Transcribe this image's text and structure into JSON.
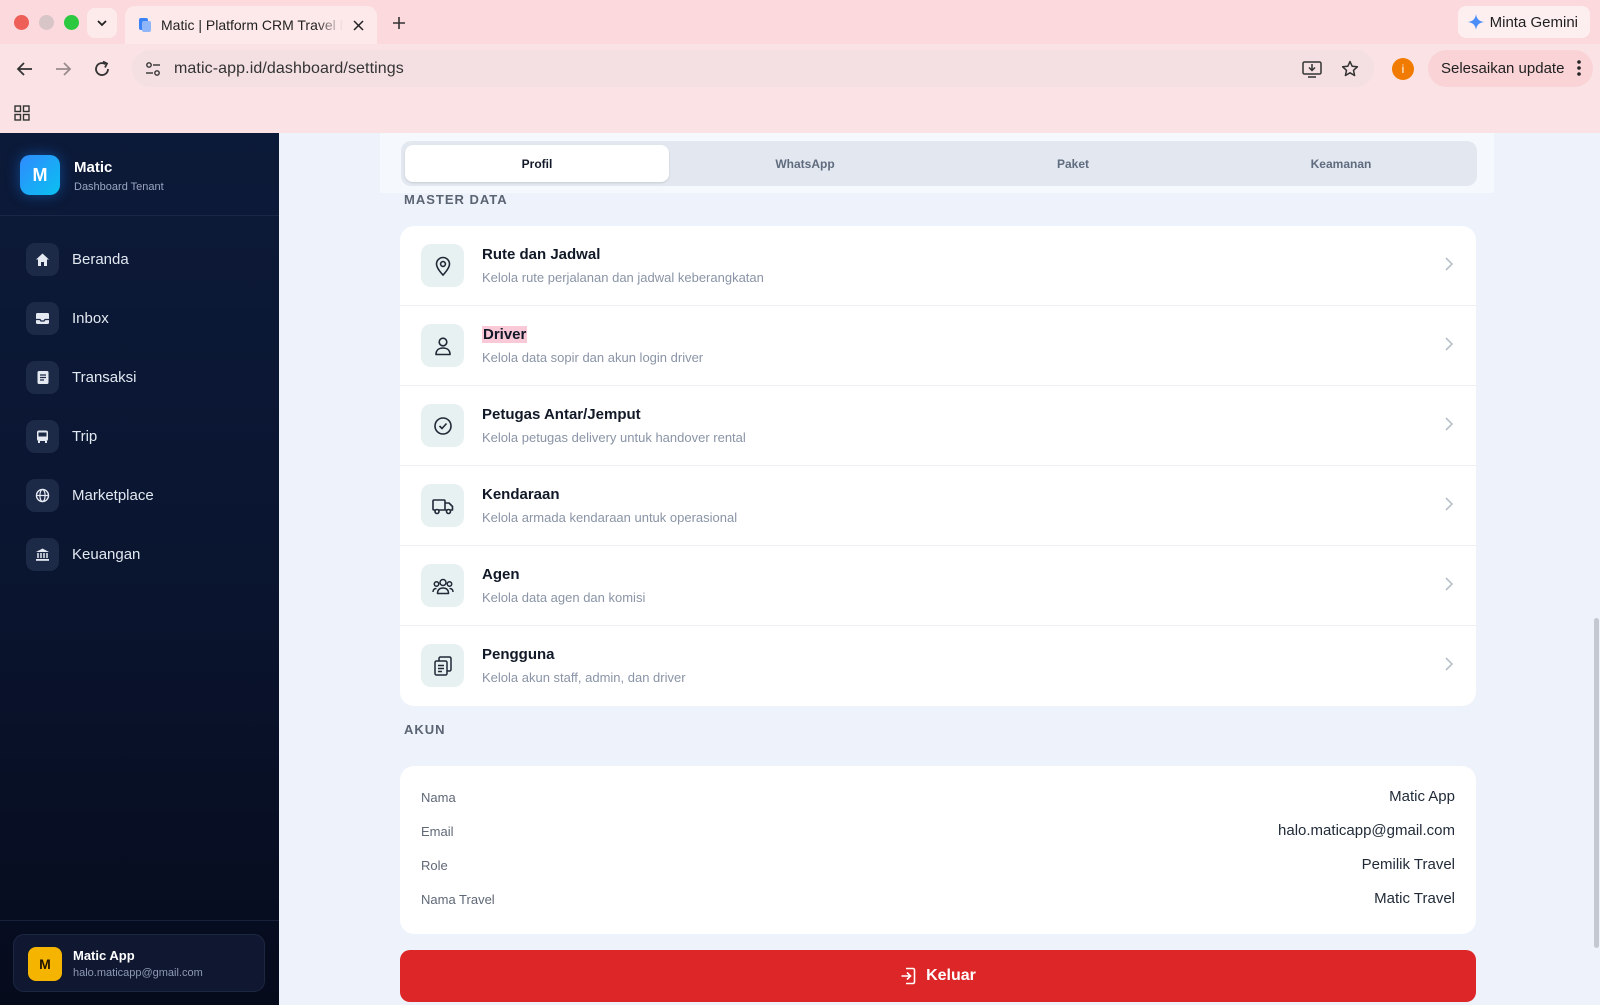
{
  "browser": {
    "tab_title": "Matic | Platform CRM Travel Dashboard",
    "url": "matic-app.id/dashboard/settings",
    "gemini_label": "Minta Gemini",
    "update_label": "Selesaikan update",
    "profile_initial": "i"
  },
  "sidebar": {
    "brand_initial": "M",
    "brand_name": "Matic",
    "brand_sub": "Dashboard Tenant",
    "items": [
      {
        "label": "Beranda",
        "icon": "home-icon"
      },
      {
        "label": "Inbox",
        "icon": "inbox-icon"
      },
      {
        "label": "Transaksi",
        "icon": "document-icon"
      },
      {
        "label": "Trip",
        "icon": "bus-icon"
      },
      {
        "label": "Marketplace",
        "icon": "globe-icon"
      },
      {
        "label": "Keuangan",
        "icon": "bank-icon"
      }
    ],
    "user": {
      "initial": "M",
      "name": "Matic App",
      "email": "halo.maticapp@gmail.com"
    }
  },
  "tabs": [
    "Profil",
    "WhatsApp",
    "Paket",
    "Keamanan"
  ],
  "active_tab": "Profil",
  "master_data": {
    "label": "MASTER DATA",
    "items": [
      {
        "title": "Rute dan Jadwal",
        "subtitle": "Kelola rute perjalanan dan jadwal keberangkatan",
        "icon": "map-pin-icon"
      },
      {
        "title": "Driver",
        "subtitle": "Kelola data sopir dan akun login driver",
        "icon": "user-icon"
      },
      {
        "title": "Petugas Antar/Jemput",
        "subtitle": "Kelola petugas delivery untuk handover rental",
        "icon": "check-circle-icon"
      },
      {
        "title": "Kendaraan",
        "subtitle": "Kelola armada kendaraan untuk operasional",
        "icon": "truck-icon"
      },
      {
        "title": "Agen",
        "subtitle": "Kelola data agen dan komisi",
        "icon": "users-icon"
      },
      {
        "title": "Pengguna",
        "subtitle": "Kelola akun staff, admin, dan driver",
        "icon": "clipboard-icon"
      }
    ]
  },
  "account": {
    "label": "AKUN",
    "rows": [
      {
        "label": "Nama",
        "value": "Matic App"
      },
      {
        "label": "Email",
        "value": "halo.maticapp@gmail.com"
      },
      {
        "label": "Role",
        "value": "Pemilik Travel"
      },
      {
        "label": "Nama Travel",
        "value": "Matic Travel"
      }
    ]
  },
  "logout_label": "Keluar",
  "colors": {
    "accent": "#2f8bff",
    "danger": "#dc2627",
    "sidebar": "#0c1a39",
    "highlight": "#f9c9d8"
  }
}
